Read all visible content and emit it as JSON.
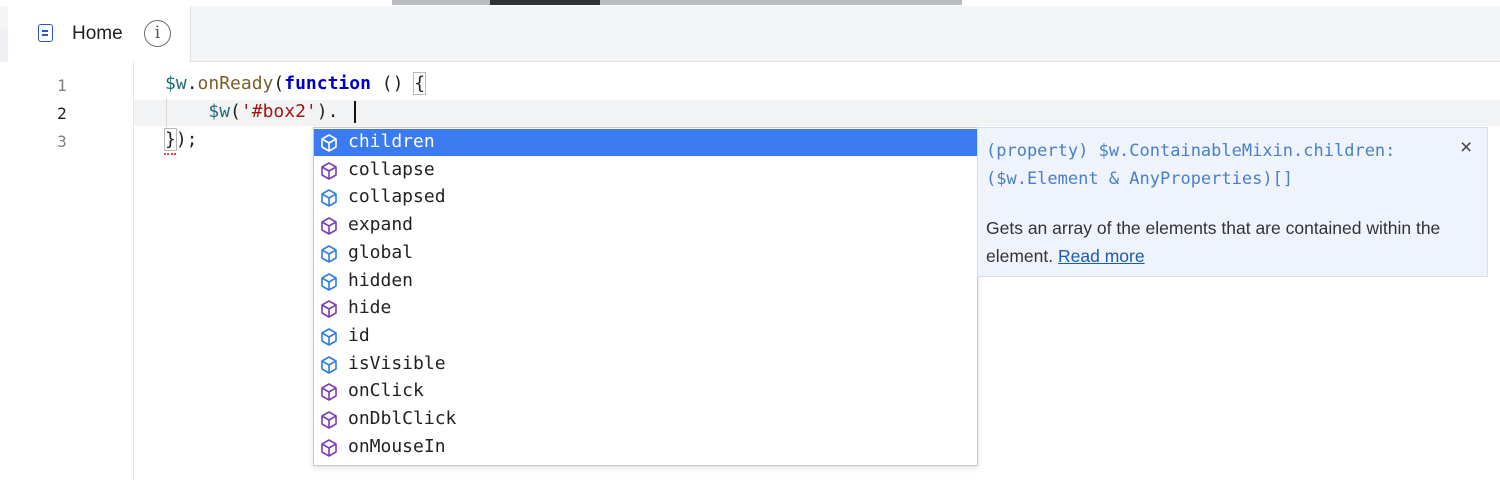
{
  "tab": {
    "label": "Home",
    "info_icon": "info-icon",
    "file_icon": "file-icon"
  },
  "gutter": {
    "line_numbers": [
      "1",
      "2",
      "3"
    ]
  },
  "code": {
    "line1": {
      "obj": "$w",
      "dot": ".",
      "fn": "onReady",
      "open": "(",
      "kw": "function",
      "rest": " () ",
      "brace": "{"
    },
    "line2": {
      "indent": "    ",
      "call": "$w",
      "paren_open": "(",
      "str": "'#box2'",
      "paren_close": ")",
      "dot": "."
    },
    "line3": {
      "brace": "}",
      "rest": ");"
    }
  },
  "suggestions": [
    {
      "label": "children",
      "kind": "property",
      "icon": "cube-property-icon",
      "selected": true
    },
    {
      "label": "collapse",
      "kind": "method",
      "icon": "cube-method-icon"
    },
    {
      "label": "collapsed",
      "kind": "property",
      "icon": "cube-property-icon"
    },
    {
      "label": "expand",
      "kind": "method",
      "icon": "cube-method-icon"
    },
    {
      "label": "global",
      "kind": "property",
      "icon": "cube-property-icon"
    },
    {
      "label": "hidden",
      "kind": "property",
      "icon": "cube-property-icon"
    },
    {
      "label": "hide",
      "kind": "method",
      "icon": "cube-method-icon"
    },
    {
      "label": "id",
      "kind": "property",
      "icon": "cube-property-icon"
    },
    {
      "label": "isVisible",
      "kind": "property",
      "icon": "cube-property-icon"
    },
    {
      "label": "onClick",
      "kind": "method",
      "icon": "cube-method-icon"
    },
    {
      "label": "onDblClick",
      "kind": "method",
      "icon": "cube-method-icon"
    },
    {
      "label": "onMouseIn",
      "kind": "method",
      "icon": "cube-method-icon"
    }
  ],
  "details": {
    "signature_line1": "(property) $w.ContainableMixin.children:",
    "signature_line2": "($w.Element & AnyProperties)[]",
    "description": "Gets an array of the elements that are contained within the element.",
    "read_more": "Read more",
    "close_label": "×"
  },
  "colors": {
    "selection": "#3a7bf2",
    "property_icon": "#2f7ed8",
    "method_icon": "#7b3fb6"
  }
}
